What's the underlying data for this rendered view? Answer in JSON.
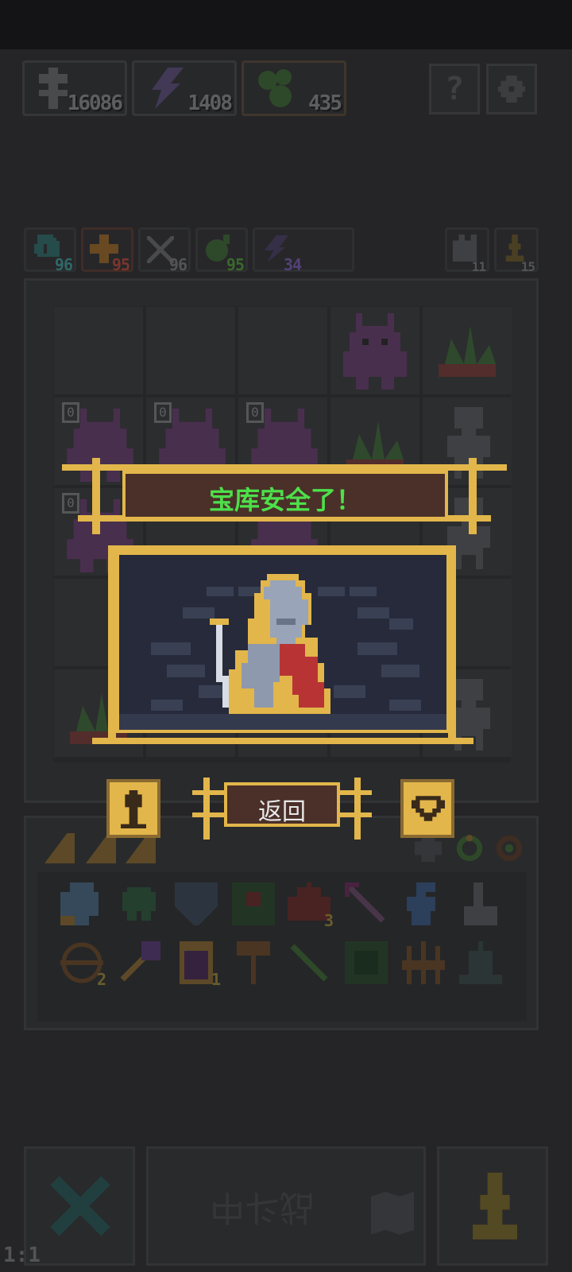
{
  "resources": [
    {
      "value": "16086",
      "icon": "skull-icon"
    },
    {
      "value": "1408",
      "icon": "lightning-icon"
    },
    {
      "value": "435",
      "icon": "slime-icon"
    }
  ],
  "top_buttons": [
    {
      "icon": "help-icon",
      "label": "?"
    },
    {
      "icon": "settings-icon"
    }
  ],
  "stats": [
    {
      "value": "96",
      "icon": "at-icon",
      "color": "#3f9c9a"
    },
    {
      "value": "95",
      "icon": "health-cross-icon",
      "color": "#b84a3a"
    },
    {
      "value": "96",
      "icon": "crossed-swords-icon",
      "color": "#8a8b8f"
    },
    {
      "value": "95",
      "icon": "green-orb-icon",
      "color": "#4f9c3a"
    },
    {
      "value": "34",
      "icon": "lightning-icon",
      "color": "#7a5cb4"
    }
  ],
  "right_stats": [
    {
      "value": "11",
      "icon": "tower-icon"
    },
    {
      "value": "15",
      "icon": "pawn-icon"
    }
  ],
  "grid_badges": [
    "0",
    "0",
    "0",
    "0"
  ],
  "dialog": {
    "title": "宝库安全了！",
    "back_label": "返回"
  },
  "inventory_counts": {
    "item5": "3",
    "item9": "2",
    "item11": "1"
  },
  "bottom": {
    "center_label": "战斗中",
    "corner_label": "1:1"
  },
  "colors": {
    "frame_gold": "#e2b64a",
    "title_green": "#4de04a",
    "banner_bg": "#4a3029",
    "dialog_bg": "#262a3a"
  }
}
